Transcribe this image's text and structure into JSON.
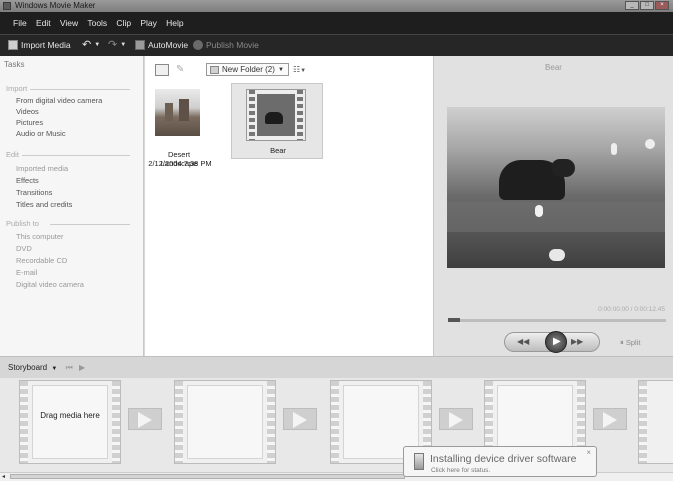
{
  "window": {
    "title": "Windows Movie Maker"
  },
  "menu": [
    "File",
    "Edit",
    "View",
    "Tools",
    "Clip",
    "Play",
    "Help"
  ],
  "toolbar": {
    "import_label": "Import Media",
    "automovie_label": "AutoMovie",
    "publish_label": "Publish Movie"
  },
  "tasks": {
    "title": "Tasks",
    "import_header": "Import",
    "import_items": [
      "From digital video camera",
      "Videos",
      "Pictures",
      "Audio or Music"
    ],
    "edit_header": "Edit",
    "edit_items": [
      "Imported media",
      "Effects",
      "Transitions",
      "Titles and credits"
    ],
    "publish_header": "Publish to",
    "publish_items": [
      "This computer",
      "DVD",
      "Recordable CD",
      "E-mail",
      "Digital video camera"
    ]
  },
  "collection": {
    "folder": "New Folder (2)",
    "items": [
      {
        "name": "Desert Landscape",
        "date": "2/12/2004 7:38 PM"
      },
      {
        "name": "Bear"
      }
    ]
  },
  "preview": {
    "title": "Bear",
    "time": "0:00:00.00 / 0:00:12.45",
    "split_label": "Split",
    "progress": 0.0
  },
  "storyboard": {
    "label": "Storyboard",
    "placeholder": "Drag media here",
    "frame_count": 5
  },
  "notification": {
    "title": "Installing device driver software",
    "subtitle": "Click here for status."
  },
  "colors": {
    "menu_bg": "#1e1e1e",
    "panel_bg": "#f6f6f6"
  }
}
